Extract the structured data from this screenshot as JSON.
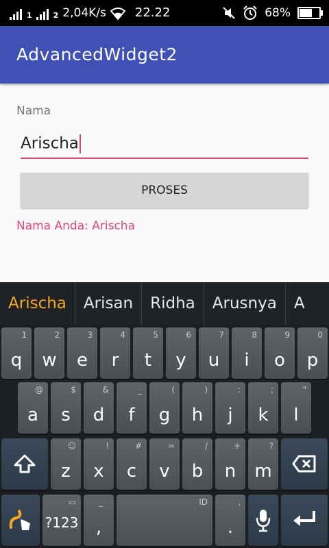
{
  "status_bar": {
    "network_speed": "2,04K/s",
    "time": "22.22",
    "battery_percent": "68%",
    "battery_level": 0.68,
    "sim1_label": "1",
    "sim2_label": "2"
  },
  "app_bar": {
    "title": "AdvancedWidget2"
  },
  "form": {
    "name_label": "Nama",
    "name_value": "Arischa",
    "button_label": "PROSES",
    "result_text": "Nama Anda: Arischa"
  },
  "colors": {
    "primary": "#3f51b5",
    "accent": "#e0457b",
    "suggestion_active": "#f5a623"
  },
  "keyboard": {
    "suggestions": [
      "Arischa",
      "Arisan",
      "Ridha",
      "Arusnya",
      "A"
    ],
    "row1": [
      {
        "main": "q",
        "hint": "1"
      },
      {
        "main": "w",
        "hint": "2"
      },
      {
        "main": "e",
        "hint": "3"
      },
      {
        "main": "r",
        "hint": "4"
      },
      {
        "main": "t",
        "hint": "5"
      },
      {
        "main": "y",
        "hint": "6"
      },
      {
        "main": "u",
        "hint": "7"
      },
      {
        "main": "i",
        "hint": "8"
      },
      {
        "main": "o",
        "hint": "9"
      },
      {
        "main": "p",
        "hint": "0"
      }
    ],
    "row2": [
      {
        "main": "a",
        "hint": "@"
      },
      {
        "main": "s",
        "hint": "$"
      },
      {
        "main": "d",
        "hint": "&"
      },
      {
        "main": "f",
        "hint": "_"
      },
      {
        "main": "g",
        "hint": "("
      },
      {
        "main": "h",
        "hint": ")"
      },
      {
        "main": "j",
        "hint": ":"
      },
      {
        "main": "k",
        "hint": ";"
      },
      {
        "main": "l",
        "hint": "\""
      }
    ],
    "row3": [
      {
        "main": "z",
        "hint": "☺"
      },
      {
        "main": "x",
        "hint": "!"
      },
      {
        "main": "c",
        "hint": "#"
      },
      {
        "main": "v",
        "hint": "="
      },
      {
        "main": "b",
        "hint": "/"
      },
      {
        "main": "n",
        "hint": "+"
      },
      {
        "main": "m",
        "hint": "?"
      }
    ],
    "shift_icon": "shift-icon",
    "backspace_icon": "backspace-icon",
    "symbols_label": "?123",
    "comma_label": ",",
    "comma_hint": "_",
    "space_hint": "ID",
    "period_label": ".",
    "period_hint": ",",
    "mic_icon": "mic-icon",
    "enter_icon": "enter-icon",
    "swype_icon": "swype-logo-icon"
  }
}
